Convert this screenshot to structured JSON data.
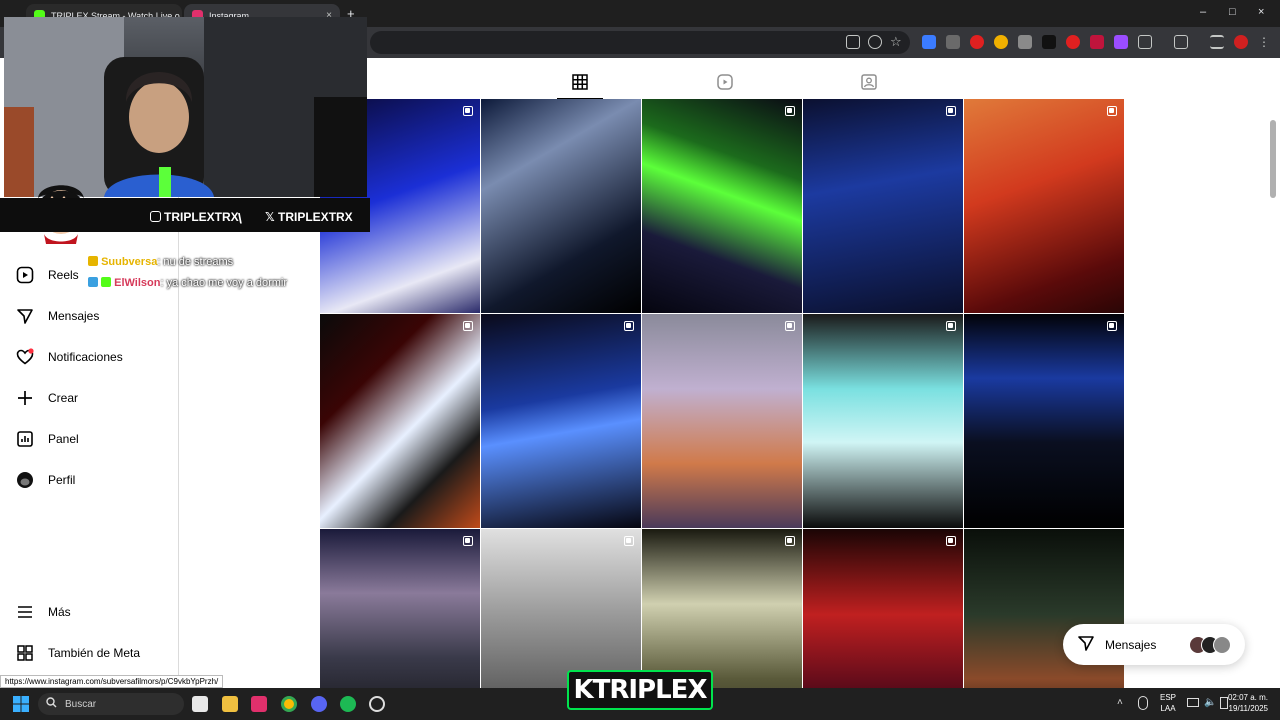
{
  "browser": {
    "tabs": [
      {
        "title": "TRIPLEX Stream - Watch Live o",
        "favicon_color": "#53fc18",
        "active": false
      },
      {
        "title": "Instagram",
        "favicon_color": "#e1306c",
        "active": true
      }
    ],
    "new_tab": "+",
    "close": "×",
    "window_controls": {
      "minimize": "–",
      "maximize": "□",
      "close": "×"
    }
  },
  "sidebar": {
    "items": [
      {
        "label": "Reels",
        "icon": "reels-icon"
      },
      {
        "label": "Mensajes",
        "icon": "messages-icon"
      },
      {
        "label": "Notificaciones",
        "icon": "heart-icon"
      },
      {
        "label": "Crear",
        "icon": "plus-icon"
      },
      {
        "label": "Panel",
        "icon": "dashboard-icon"
      },
      {
        "label": "Perfil",
        "icon": "profile-avatar-icon"
      }
    ],
    "bottom_items": [
      {
        "label": "Más",
        "icon": "menu-icon"
      },
      {
        "label": "También de Meta",
        "icon": "meta-icon"
      }
    ]
  },
  "overlay": {
    "instagram_handle": "TRIPLEXTRX",
    "x_handle": "TRIPLEXTRX",
    "separator": "\\",
    "chat": [
      {
        "user": "Suubversa",
        "color": "#e6b400",
        "text": ": nu de streams"
      },
      {
        "user": "ElWilson",
        "color": "#d63a5a",
        "text": ": ya chao me voy a dormir"
      }
    ]
  },
  "messages_pill": {
    "label": "Mensajes"
  },
  "status_url": "https://www.instagram.com/subversafilmors/p/C9vkbYpPrzh/",
  "taskbar": {
    "search_placeholder": "Buscar",
    "language": {
      "line1": "ESP",
      "line2": "LAA"
    },
    "time": "02:07 a. m.",
    "date": "19/11/2025"
  },
  "stream_logo": "KTRIPLEX",
  "posts": [
    {
      "bg": "linear-gradient(160deg,#0a0a3a 0%,#1b2fd6 45%,#e8e8f5 80%,#2a2a6a 100%)",
      "multi": true
    },
    {
      "bg": "linear-gradient(150deg,#0d1a3a 0%,#7a8cb0 30%,#10182c 70%,#000 100%)",
      "multi": false
    },
    {
      "bg": "linear-gradient(200deg,#0a0a14 0%,#1c6b1c 30%,#5cff3a 45%,#1a1a3a 70%,#05050f 100%)",
      "multi": true
    },
    {
      "bg": "linear-gradient(170deg,#0b1030 0%,#1c3aa0 40%,#0a0f2a 100%)",
      "multi": true
    },
    {
      "bg": "linear-gradient(160deg,#e07a3a 0%,#d23a1e 40%,#5a0a0a 80%,#2a0505 100%)",
      "multi": true
    },
    {
      "bg": "linear-gradient(135deg,#0a0a0a 0%,#3a0505 30%,#e8f0ff 55%,#1a1a1a 75%,#c04a1a 100%)",
      "multi": true
    },
    {
      "bg": "linear-gradient(170deg,#0a0a1a 0%,#1a3aa0 40%,#5a90ff 55%,#05050f 100%)",
      "multi": true
    },
    {
      "bg": "linear-gradient(180deg,#8a8a9a 0%,#c0b0d0 35%,#d07a4a 70%,#4a3a5a 100%)",
      "multi": true
    },
    {
      "bg": "linear-gradient(180deg,#1a1a1a 0%,#7ae0e0 35%,#d0f5f5 60%,#0a0a0a 100%)",
      "multi": true
    },
    {
      "bg": "linear-gradient(180deg,#020208 0%,#1a3aa0 30%,#0a0f20 60%,#000 100%)",
      "multi": true
    },
    {
      "bg": "linear-gradient(180deg,#1a1a3a 0%,#8a7a9a 30%,#3a3a4a 60%,#0a0a0a 100%)",
      "multi": true
    },
    {
      "bg": "linear-gradient(180deg,#e0e0e0 0%,#9a9a9a 40%,#3a3a3a 100%)",
      "multi": true
    },
    {
      "bg": "linear-gradient(180deg,#1a1a10 0%,#d0d0b0 35%,#5a5a3a 70%,#2a2a1a 100%)",
      "multi": true
    },
    {
      "bg": "linear-gradient(180deg,#1a0505 0%,#c02020 40%,#5a0a1a 75%,#1a0a2a 100%)",
      "multi": true
    },
    {
      "bg": "linear-gradient(180deg,#0a0f0a 0%,#2a3a2a 40%,#8a4a2a 70%,#0a0a0a 100%)",
      "multi": false
    }
  ]
}
